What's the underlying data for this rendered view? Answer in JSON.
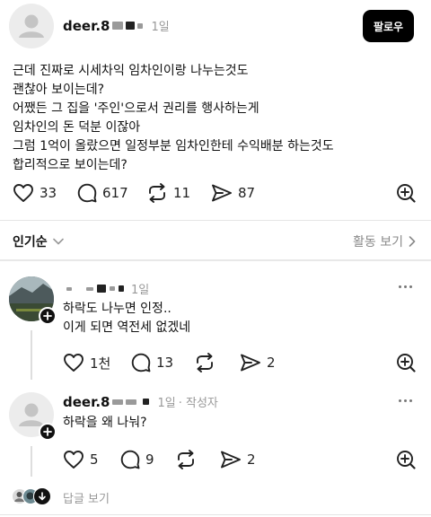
{
  "post": {
    "username": "deer.8",
    "time": "1일",
    "follow_label": "팔로우",
    "lines": [
      "근데 진짜로 시세차익 임차인이랑 나누는것도",
      "괜찮아 보이는데?",
      "어쨌든 그 집을 '주인'으로서 권리를 행사하는게",
      "임차인의 돈 덕분 이잖아",
      "그럼 1억이 올랐으면 일정부분 임차인한테 수익배분 하는것도",
      "합리적으로 보이는데?"
    ],
    "likes": "33",
    "comments": "617",
    "reposts": "11",
    "shares": "87"
  },
  "sort": {
    "label": "인기순",
    "activity_label": "활동 보기"
  },
  "comments": [
    {
      "username": "",
      "time": "1일",
      "author_tag": "",
      "lines": [
        "하락도 나누면 인정..",
        "이게 되면 역전세 없겠네"
      ],
      "likes": "1천",
      "comments": "13",
      "reposts": "",
      "shares": "2"
    },
    {
      "username": "deer.8",
      "time": "1일",
      "author_tag": "· 작성자",
      "lines": [
        "하락을 왜 나눠?"
      ],
      "likes": "5",
      "comments": "9",
      "reposts": "",
      "shares": "2"
    }
  ],
  "replies": {
    "label": "답글 보기"
  },
  "colors": {
    "follow_bg": "#000000",
    "text": "#101010",
    "muted": "#999999"
  }
}
